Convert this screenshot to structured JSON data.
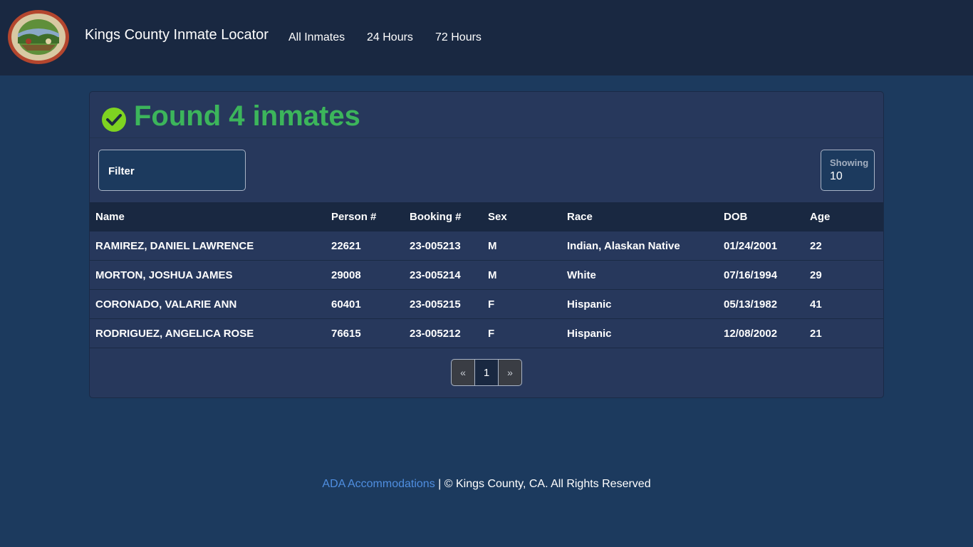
{
  "header": {
    "logo_icon": "kings-county-seal-icon",
    "brand": "Kings County Inmate Locator",
    "nav": [
      "All Inmates",
      "24 Hours",
      "72 Hours"
    ]
  },
  "results": {
    "title": "Found 4 inmates",
    "status_icon": "check-circle-icon",
    "status_color": "#3cb55b",
    "filter_label": "Filter",
    "showing_label": "Showing",
    "showing_value": "10"
  },
  "table": {
    "columns": [
      "Name",
      "Person #",
      "Booking #",
      "Sex",
      "Race",
      "DOB",
      "Age"
    ],
    "rows": [
      [
        "RAMIREZ, DANIEL LAWRENCE",
        "22621",
        "23-005213",
        "M",
        "Indian, Alaskan Native",
        "01/24/2001",
        "22"
      ],
      [
        "MORTON, JOSHUA JAMES",
        "29008",
        "23-005214",
        "M",
        "White",
        "07/16/1994",
        "29"
      ],
      [
        "CORONADO, VALARIE ANN",
        "60401",
        "23-005215",
        "F",
        "Hispanic",
        "05/13/1982",
        "41"
      ],
      [
        "RODRIGUEZ, ANGELICA ROSE",
        "76615",
        "23-005212",
        "F",
        "Hispanic",
        "12/08/2002",
        "21"
      ]
    ]
  },
  "pagination": {
    "prev": "«",
    "current": "1",
    "next": "»"
  },
  "footer": {
    "link": "ADA Accommodations",
    "text": " | © Kings County, CA. All Rights Reserved"
  }
}
